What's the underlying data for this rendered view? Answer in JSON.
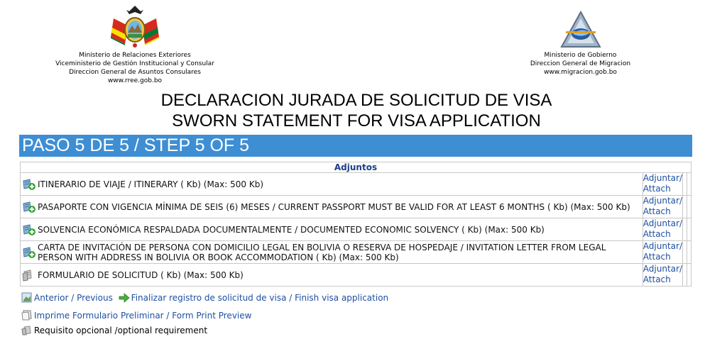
{
  "header": {
    "left": {
      "lines": [
        "Ministerio de Relaciones Exteriores",
        "Viceministerio de Gestión Institucional y Consular",
        "Direccion General de Asuntos Consulares",
        "www.rree.gob.bo"
      ]
    },
    "right": {
      "lines": [
        "Ministerio de Gobierno",
        "Direccion General de Migracion",
        "www.migracion.gob.bo"
      ]
    }
  },
  "title": {
    "line1": "DECLARACION JURADA DE SOLICITUD DE VISA",
    "line2": "SWORN STATEMENT FOR VISA APPLICATION"
  },
  "step": {
    "label": "PASO 5 DE 5 / STEP 5 OF 5",
    "color": "#3e8ed4"
  },
  "attachments": {
    "header": "Adjuntos",
    "action_line1": "Adjuntar/",
    "action_line2": "Attach",
    "rows": [
      {
        "text": "ITINERARIO DE VIAJE / ITINERARY ( Kb) (Max: 500 Kb)",
        "icon": "required-attachment-icon"
      },
      {
        "text": "PASAPORTE CON VIGENCIA MÍNIMA DE SEIS (6) MESES / CURRENT PASSPORT MUST BE VALID FOR AT LEAST 6 MONTHS ( Kb) (Max: 500 Kb)",
        "icon": "required-attachment-icon"
      },
      {
        "text": "SOLVENCIA ECONÓMICA RESPALDADA DOCUMENTALMENTE / DOCUMENTED ECONOMIC SOLVENCY ( Kb) (Max: 500 Kb)",
        "icon": "required-attachment-icon"
      },
      {
        "text": "CARTA DE INVITACIÓN DE PERSONA CON DOMICILIO LEGAL EN BOLIVIA O RESERVA DE HOSPEDAJE / INVITATION LETTER FROM LEGAL PERSON WITH ADDRESS IN BOLIVIA OR BOOK ACCOMMODATION ( Kb) (Max: 500 Kb)",
        "icon": "required-attachment-icon"
      },
      {
        "text": "FORMULARIO DE SOLICITUD ( Kb) (Max: 500 Kb)",
        "icon": "optional-attachment-icon"
      }
    ]
  },
  "nav": {
    "previous": "Anterior / Previous",
    "finish": "Finalizar registro de solicitud de visa / Finish visa application",
    "print_preview": "Imprime Formulario Preliminar / Form Print Preview",
    "optional_note": "Requisito opcional /optional requirement"
  },
  "colors": {
    "link": "#1f4fa0",
    "header_text": "#1a3f86",
    "required_icon_plus": "#3aa63a",
    "finish_arrow": "#4cae3c"
  }
}
